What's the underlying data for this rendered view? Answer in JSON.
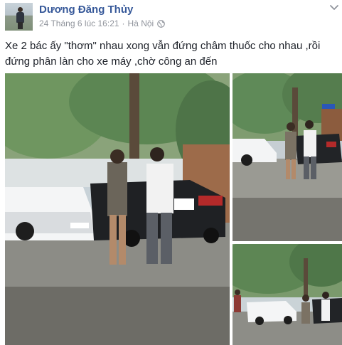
{
  "post": {
    "author": "Dương Đăng Thủy",
    "timestamp": "24 Tháng 6 lúc 16:21",
    "separator": "·",
    "location": "Hà Nội",
    "privacy_icon": "globe-icon",
    "menu_icon": "chevron-down-icon",
    "text": "Xe 2 bác ấy \"thơm\" nhau xong vẫn đứng châm thuốc cho nhau ,rồi đứng phân làn cho xe máy ,chờ công an đến"
  },
  "photos": [
    {
      "name": "photo-main",
      "subject": "two men standing between two cars on a tree-lined street"
    },
    {
      "name": "photo-top-right",
      "subject": "two men beside a white car and a dark car"
    },
    {
      "name": "photo-bottom-right",
      "subject": "street scene with white car and bystanders"
    }
  ],
  "colors": {
    "link": "#365899",
    "meta": "#90949c",
    "text": "#1d2129"
  }
}
